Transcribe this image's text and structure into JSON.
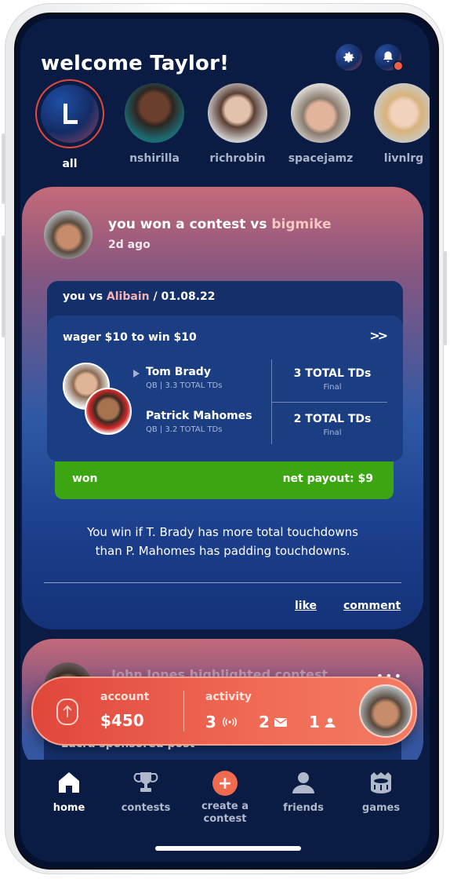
{
  "header": {
    "welcome": "welcome Taylor!"
  },
  "stories": [
    {
      "name": "all",
      "initial": "L"
    },
    {
      "name": "nshirilla"
    },
    {
      "name": "richrobin"
    },
    {
      "name": "spacejamz"
    },
    {
      "name": "livnlrg"
    }
  ],
  "post": {
    "title_prefix": "you won a contest vs",
    "opponent": "bigmike",
    "time": "2d ago",
    "contest": {
      "vs_prefix": "you vs",
      "vs_name": "Alibain",
      "date": "/  01.08.22",
      "wager": "wager $10 to win $10",
      "chevron": ">>",
      "players": [
        {
          "name": "Tom Brady",
          "sub": "QB | 3.3 TOTAL TDs",
          "result": "3 TOTAL TDs",
          "status": "Final"
        },
        {
          "name": "Patrick Mahomes",
          "sub": "QB | 3.2 TOTAL TDs",
          "result": "2 TOTAL TDs",
          "status": "Final"
        }
      ],
      "outcome": "won",
      "payout": "net payout: $9"
    },
    "description_line1": "You win if T. Brady has more total touchdowns",
    "description_line2": "than P. Mahomes has padding touchdowns.",
    "like": "like",
    "comment": "comment"
  },
  "post2": {
    "title": "John Jones highlighted contest",
    "sponsor": "Lucra sponsored post"
  },
  "account_bar": {
    "account_label": "account",
    "balance": "$450",
    "activity_label": "activity",
    "live_count": "3",
    "message_count": "2",
    "friend_count": "1"
  },
  "nav": [
    {
      "label": "home"
    },
    {
      "label": "contests"
    },
    {
      "label": "create a contest"
    },
    {
      "label": "friends"
    },
    {
      "label": "games"
    }
  ],
  "colors": {
    "accent": "#ef6a4f",
    "won": "#3ca612",
    "background": "#0a1c44",
    "highlight": "#f6c6c3"
  }
}
